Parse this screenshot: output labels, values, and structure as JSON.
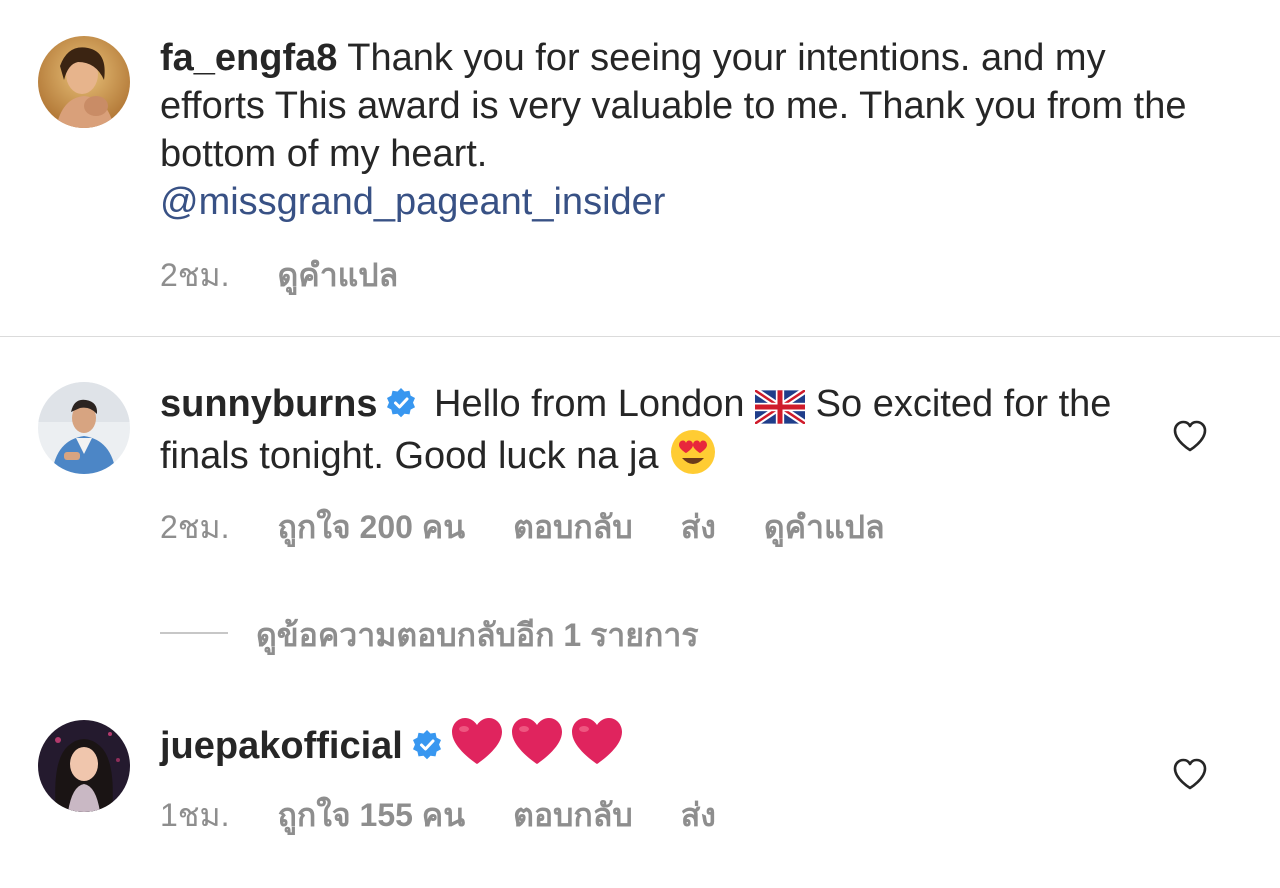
{
  "comments": [
    {
      "username": "fa_engfa8",
      "text": " Thank you for seeing your intentions.  and my efforts  This award is very valuable to me. Thank you from the bottom of my heart. ",
      "mention": "@missgrand_pageant_insider",
      "time": "2ชม.",
      "translate": "ดูคำแปล"
    },
    {
      "username": "sunnyburns",
      "verified": true,
      "text_before_flag": " Hello from London ",
      "text_after_flag": " So excited for the finals tonight. Good luck na ja ",
      "time": "2ชม.",
      "likes": "ถูกใจ 200 คน",
      "reply": "ตอบกลับ",
      "send": "ส่ง",
      "translate": "ดูคำแปล",
      "view_replies": "ดูข้อความตอบกลับอีก 1 รายการ"
    },
    {
      "username": "juepakofficial",
      "verified": true,
      "time": "1ชม.",
      "likes": "ถูกใจ 155 คน",
      "reply": "ตอบกลับ",
      "send": "ส่ง"
    }
  ],
  "colors": {
    "text": "#262626",
    "secondary": "#8e8e8e",
    "link": "#385185",
    "verified": "#3897f0",
    "heart_emoji": "#e0245e"
  },
  "icons": [
    "verified-badge-icon",
    "heart-outline-icon",
    "uk-flag-emoji",
    "heart-eyes-emoji",
    "red-heart-emoji"
  ]
}
